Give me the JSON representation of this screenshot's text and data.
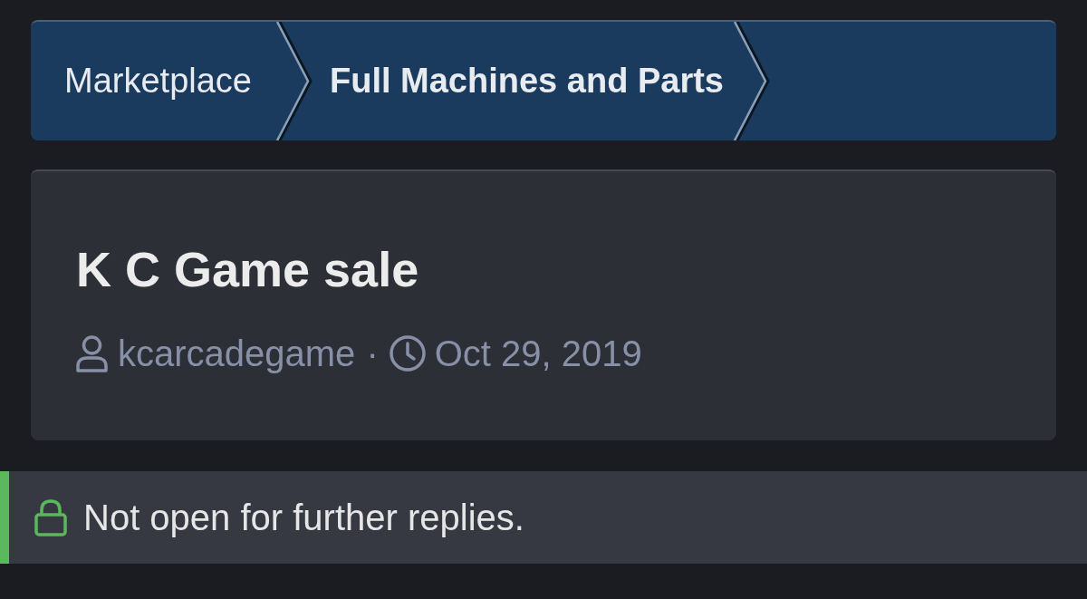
{
  "breadcrumbs": [
    {
      "label": "Marketplace",
      "current": false
    },
    {
      "label": "Full Machines and Parts",
      "current": true
    }
  ],
  "thread": {
    "title": "K C Game sale",
    "author": "kcarcadegame",
    "separator": "·",
    "date": "Oct 29, 2019"
  },
  "notice": {
    "text": "Not open for further replies."
  }
}
